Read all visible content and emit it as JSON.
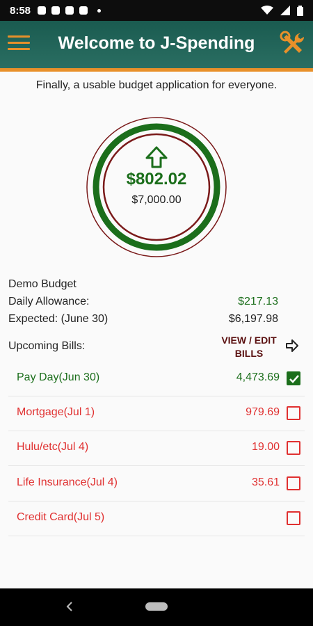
{
  "status_bar": {
    "time": "8:58"
  },
  "app_bar": {
    "title": "Welcome to J-Spending"
  },
  "tagline": "Finally, a usable budget application for everyone.",
  "gauge": {
    "amount": "$802.02",
    "total": "$7,000.00",
    "trend": "up-arrow-icon"
  },
  "budget": {
    "name": "Demo Budget",
    "daily_allowance_label": "Daily Allowance:",
    "daily_allowance_value": "$217.13",
    "expected_label": "Expected: (June 30)",
    "expected_value": "$6,197.98"
  },
  "bills_header": {
    "label": "Upcoming Bills:",
    "view_edit": "VIEW / EDIT BILLS"
  },
  "bills": [
    {
      "name": "Pay Day(Jun 30)",
      "amount": "4,473.69",
      "checked": true,
      "color": "#1b6e1b"
    },
    {
      "name": "Mortgage(Jul 1)",
      "amount": "979.69",
      "checked": false,
      "color": "#e03030"
    },
    {
      "name": "Hulu/etc(Jul 4)",
      "amount": "19.00",
      "checked": false,
      "color": "#e03030"
    },
    {
      "name": "Life Insurance(Jul 4)",
      "amount": "35.61",
      "checked": false,
      "color": "#e03030"
    },
    {
      "name": "Credit Card(Jul 5)",
      "amount": "",
      "checked": false,
      "color": "#e03030"
    }
  ],
  "colors": {
    "primary": "#1a5b50",
    "accent": "#e8902a",
    "positive": "#1b6e1b",
    "negative": "#e03030",
    "ring_outer": "#7a1a1a"
  }
}
